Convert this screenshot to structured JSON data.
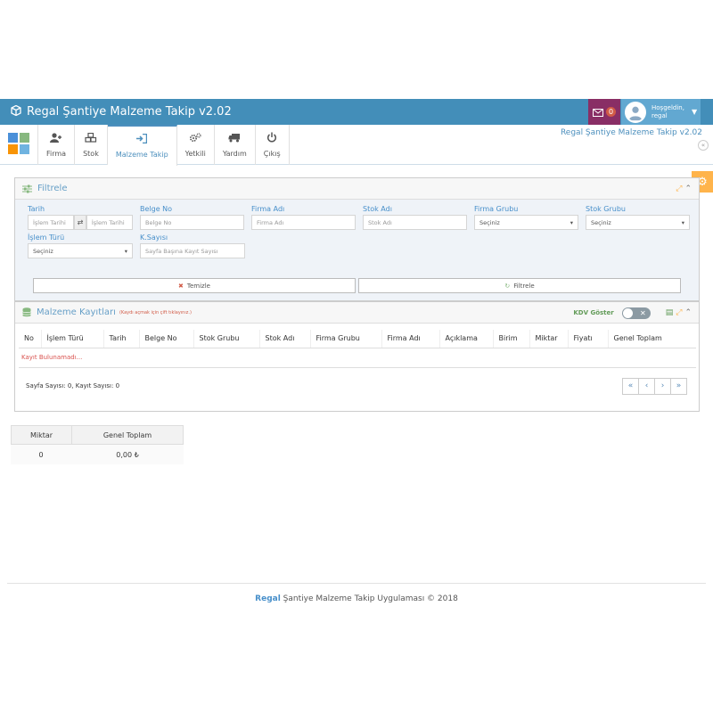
{
  "navbar": {
    "brand_title": "Regal Şantiye Malzeme Takip v2.02",
    "message_count": "0",
    "user_greeting": "Hoşgeldin,",
    "user_name": "regal"
  },
  "toolbar": {
    "tabs": [
      {
        "label": "Firma",
        "icon": "user-plus-icon"
      },
      {
        "label": "Stok",
        "icon": "cubes-icon"
      },
      {
        "label": "Malzeme Takip",
        "icon": "sign-in-icon"
      },
      {
        "label": "Yetkili",
        "icon": "gears-icon"
      },
      {
        "label": "Yardım",
        "icon": "truck-icon"
      },
      {
        "label": "Çıkış",
        "icon": "power-icon"
      }
    ],
    "active_tab": "Malzeme Takip",
    "right_title": "Regal Şantiye Malzeme Takip v2.02"
  },
  "filter": {
    "title": "Filtrele",
    "fields": {
      "tarih_label": "Tarih",
      "tarih_start_placeholder": "İşlem Tarihi",
      "tarih_end_placeholder": "İşlem Tarihi",
      "belge_label": "Belge No",
      "belge_placeholder": "Belge No",
      "firma_adi_label": "Firma Adı",
      "firma_adi_placeholder": "Firma Adı",
      "stok_adi_label": "Stok Adı",
      "stok_adi_placeholder": "Stok Adı",
      "firma_grubu_label": "Firma Grubu",
      "firma_grubu_value": "Seçiniz",
      "stok_grubu_label": "Stok Grubu",
      "stok_grubu_value": "Seçiniz",
      "islem_turu_label": "İşlem Türü",
      "islem_turu_value": "Seçiniz",
      "ksayisi_label": "K.Sayısı",
      "ksayisi_placeholder": "Sayfa Başına Kayıt Sayısı"
    },
    "clear_label": "Temizle",
    "filter_label": "Filtrele"
  },
  "records": {
    "title": "Malzeme Kayıtları",
    "subtitle": "(Kaydı açmak için çift tıklayınız.)",
    "kdv_label": "KDV Göster",
    "columns": [
      "No",
      "İşlem Türü",
      "Tarih",
      "Belge No",
      "Stok Grubu",
      "Stok Adı",
      "Firma Grubu",
      "Firma Adı",
      "Açıklama",
      "Birim",
      "Miktar",
      "Fiyatı",
      "Genel Toplam"
    ],
    "empty_message": "Kayıt Bulunamadı...",
    "page_info": "Sayfa Sayısı: 0, Kayıt Sayısı: 0"
  },
  "totals": {
    "miktar_label": "Miktar",
    "genel_toplam_label": "Genel Toplam",
    "miktar_value": "0",
    "genel_toplam_value": "0,00 ₺"
  },
  "footer": {
    "brand": "Regal",
    "text": "Şantiye Malzeme Takip Uygulaması © 2018"
  },
  "colors": {
    "navbar": "#438eb9",
    "accent": "#478fca",
    "messages": "#892e65",
    "settings": "#ffb44b"
  }
}
